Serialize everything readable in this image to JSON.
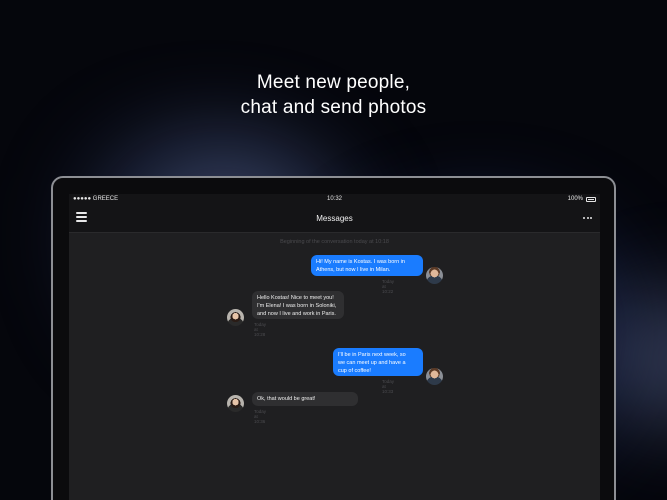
{
  "headline": {
    "line1": "Meet new people,",
    "line2": "chat and send photos"
  },
  "statusbar": {
    "carrier": "●●●●● GREECE",
    "time": "10:32",
    "battery": "100%"
  },
  "navbar": {
    "title": "Messages"
  },
  "thread": {
    "beginning": "Beginning of the conversation today at 10:18",
    "messages": [
      {
        "direction": "out",
        "text": "Hi! My name is Kostas. I was born in\nAthens, but now I live in Milan.",
        "stamp": "Today at 10:22"
      },
      {
        "direction": "in",
        "text": "Hello Kostas! Nice to meet you!\nI'm Elena! I was born in Soloniki,\nand now I live and work in Paris.",
        "stamp": "Today at 10:28"
      },
      {
        "direction": "out",
        "text": "I'll be in Paris next week, so\nwe can meet up and have a\ncup of coffee!",
        "stamp": "Today at 10:33"
      },
      {
        "direction": "in",
        "text": "Ok, that would be great!",
        "stamp": "Today at 10:36"
      }
    ]
  },
  "colors": {
    "outgoing_bubble": "#1a7cff",
    "incoming_bubble": "#2f2f31",
    "screen_bg": "#1f1f21"
  }
}
